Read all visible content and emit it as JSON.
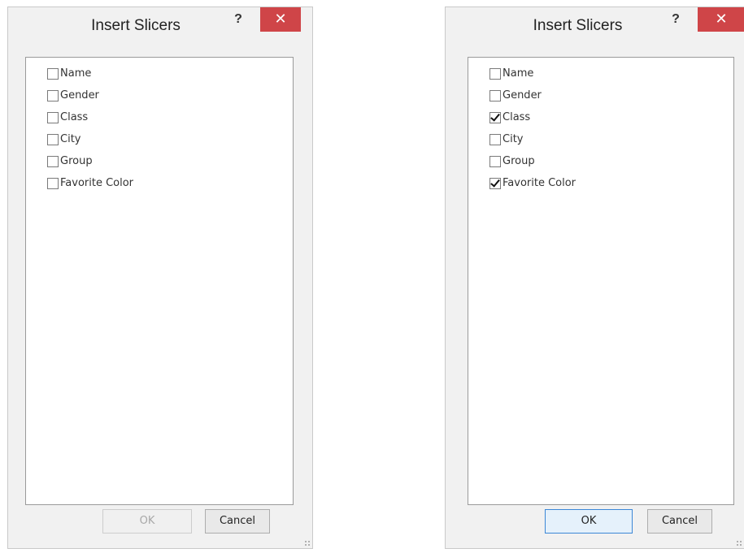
{
  "dialogs": [
    {
      "title": "Insert Slicers",
      "help_label": "?",
      "close_label": "✕",
      "fields": [
        {
          "label": "Name",
          "checked": false
        },
        {
          "label": "Gender",
          "checked": false
        },
        {
          "label": "Class",
          "checked": false
        },
        {
          "label": "City",
          "checked": false
        },
        {
          "label": "Group",
          "checked": false
        },
        {
          "label": "Favorite Color",
          "checked": false
        }
      ],
      "ok_label": "OK",
      "ok_enabled": false,
      "cancel_label": "Cancel"
    },
    {
      "title": "Insert Slicers",
      "help_label": "?",
      "close_label": "✕",
      "fields": [
        {
          "label": "Name",
          "checked": false
        },
        {
          "label": "Gender",
          "checked": false
        },
        {
          "label": "Class",
          "checked": true
        },
        {
          "label": "City",
          "checked": false
        },
        {
          "label": "Group",
          "checked": false
        },
        {
          "label": "Favorite Color",
          "checked": true
        }
      ],
      "ok_label": "OK",
      "ok_enabled": true,
      "cancel_label": "Cancel"
    }
  ],
  "colors": {
    "close_button": "#cf4548",
    "dialog_background": "#f1f1f1",
    "default_button_border": "#3c87d6"
  },
  "icons": {
    "help": "question-mark-icon",
    "close": "close-icon",
    "checkbox": "checkbox-icon",
    "checkmark": "checkmark-icon",
    "grip": "resize-grip-icon"
  }
}
